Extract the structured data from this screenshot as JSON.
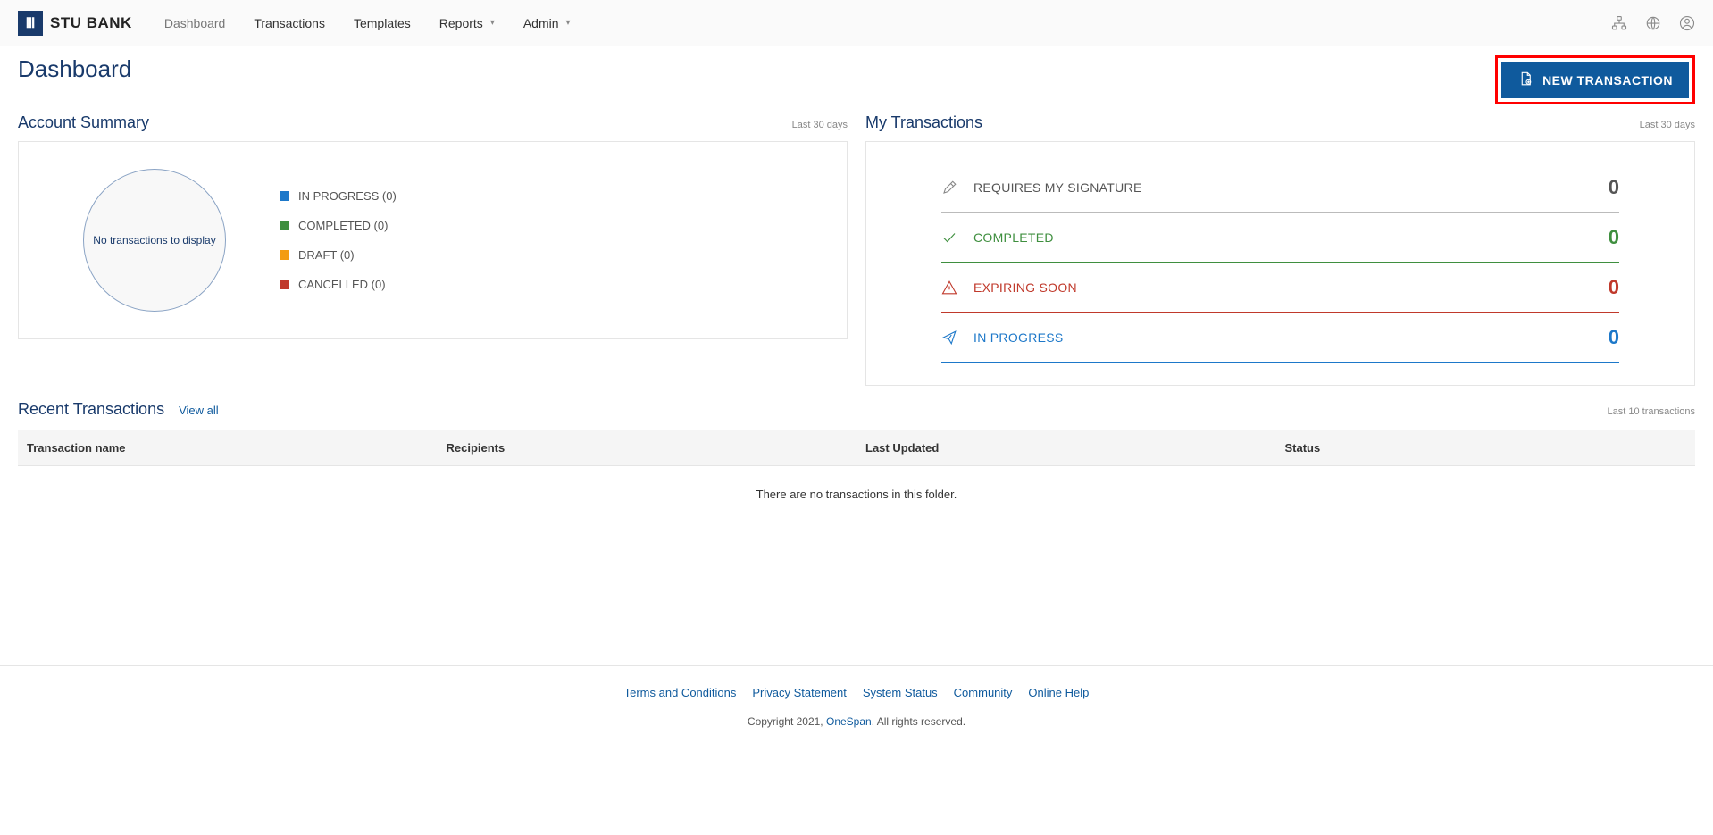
{
  "brand": {
    "name": "STU BANK",
    "logo_glyph": "Ⅲ"
  },
  "nav": {
    "items": [
      {
        "label": "Dashboard",
        "active": true,
        "dropdown": false
      },
      {
        "label": "Transactions",
        "active": false,
        "dropdown": false
      },
      {
        "label": "Templates",
        "active": false,
        "dropdown": false
      },
      {
        "label": "Reports",
        "active": false,
        "dropdown": true
      },
      {
        "label": "Admin",
        "active": false,
        "dropdown": true
      }
    ]
  },
  "page": {
    "title": "Dashboard",
    "new_transaction_label": "NEW TRANSACTION"
  },
  "account_summary": {
    "title": "Account Summary",
    "period": "Last 30 days",
    "empty_chart_text": "No transactions to display",
    "legend": [
      {
        "label": "IN PROGRESS (0)",
        "swatch_class": "sw-inprogress"
      },
      {
        "label": "COMPLETED (0)",
        "swatch_class": "sw-completed"
      },
      {
        "label": "DRAFT (0)",
        "swatch_class": "sw-draft"
      },
      {
        "label": "CANCELLED (0)",
        "swatch_class": "sw-cancelled"
      }
    ]
  },
  "my_transactions": {
    "title": "My Transactions",
    "period": "Last 30 days",
    "rows": [
      {
        "key": "requires",
        "label": "REQUIRES MY SIGNATURE",
        "count": "0"
      },
      {
        "key": "completed",
        "label": "COMPLETED",
        "count": "0"
      },
      {
        "key": "expiring",
        "label": "EXPIRING SOON",
        "count": "0"
      },
      {
        "key": "inprogress",
        "label": "IN PROGRESS",
        "count": "0"
      }
    ]
  },
  "recent": {
    "title": "Recent Transactions",
    "view_all": "View all",
    "period": "Last 10 transactions",
    "columns": [
      "Transaction name",
      "Recipients",
      "Last Updated",
      "Status"
    ],
    "empty_message": "There are no transactions in this folder."
  },
  "footer": {
    "links": [
      "Terms and Conditions",
      "Privacy Statement",
      "System Status",
      "Community",
      "Online Help"
    ],
    "copyright_prefix": "Copyright 2021, ",
    "copyright_link": "OneSpan",
    "copyright_suffix": ". All rights reserved."
  }
}
